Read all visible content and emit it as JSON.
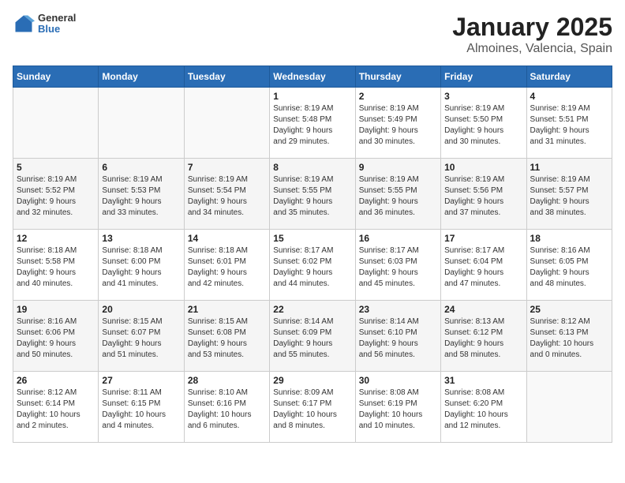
{
  "logo": {
    "general": "General",
    "blue": "Blue"
  },
  "title": "January 2025",
  "subtitle": "Almoines, Valencia, Spain",
  "weekdays": [
    "Sunday",
    "Monday",
    "Tuesday",
    "Wednesday",
    "Thursday",
    "Friday",
    "Saturday"
  ],
  "weeks": [
    [
      {
        "day": "",
        "info": ""
      },
      {
        "day": "",
        "info": ""
      },
      {
        "day": "",
        "info": ""
      },
      {
        "day": "1",
        "info": "Sunrise: 8:19 AM\nSunset: 5:48 PM\nDaylight: 9 hours\nand 29 minutes."
      },
      {
        "day": "2",
        "info": "Sunrise: 8:19 AM\nSunset: 5:49 PM\nDaylight: 9 hours\nand 30 minutes."
      },
      {
        "day": "3",
        "info": "Sunrise: 8:19 AM\nSunset: 5:50 PM\nDaylight: 9 hours\nand 30 minutes."
      },
      {
        "day": "4",
        "info": "Sunrise: 8:19 AM\nSunset: 5:51 PM\nDaylight: 9 hours\nand 31 minutes."
      }
    ],
    [
      {
        "day": "5",
        "info": "Sunrise: 8:19 AM\nSunset: 5:52 PM\nDaylight: 9 hours\nand 32 minutes."
      },
      {
        "day": "6",
        "info": "Sunrise: 8:19 AM\nSunset: 5:53 PM\nDaylight: 9 hours\nand 33 minutes."
      },
      {
        "day": "7",
        "info": "Sunrise: 8:19 AM\nSunset: 5:54 PM\nDaylight: 9 hours\nand 34 minutes."
      },
      {
        "day": "8",
        "info": "Sunrise: 8:19 AM\nSunset: 5:55 PM\nDaylight: 9 hours\nand 35 minutes."
      },
      {
        "day": "9",
        "info": "Sunrise: 8:19 AM\nSunset: 5:55 PM\nDaylight: 9 hours\nand 36 minutes."
      },
      {
        "day": "10",
        "info": "Sunrise: 8:19 AM\nSunset: 5:56 PM\nDaylight: 9 hours\nand 37 minutes."
      },
      {
        "day": "11",
        "info": "Sunrise: 8:19 AM\nSunset: 5:57 PM\nDaylight: 9 hours\nand 38 minutes."
      }
    ],
    [
      {
        "day": "12",
        "info": "Sunrise: 8:18 AM\nSunset: 5:58 PM\nDaylight: 9 hours\nand 40 minutes."
      },
      {
        "day": "13",
        "info": "Sunrise: 8:18 AM\nSunset: 6:00 PM\nDaylight: 9 hours\nand 41 minutes."
      },
      {
        "day": "14",
        "info": "Sunrise: 8:18 AM\nSunset: 6:01 PM\nDaylight: 9 hours\nand 42 minutes."
      },
      {
        "day": "15",
        "info": "Sunrise: 8:17 AM\nSunset: 6:02 PM\nDaylight: 9 hours\nand 44 minutes."
      },
      {
        "day": "16",
        "info": "Sunrise: 8:17 AM\nSunset: 6:03 PM\nDaylight: 9 hours\nand 45 minutes."
      },
      {
        "day": "17",
        "info": "Sunrise: 8:17 AM\nSunset: 6:04 PM\nDaylight: 9 hours\nand 47 minutes."
      },
      {
        "day": "18",
        "info": "Sunrise: 8:16 AM\nSunset: 6:05 PM\nDaylight: 9 hours\nand 48 minutes."
      }
    ],
    [
      {
        "day": "19",
        "info": "Sunrise: 8:16 AM\nSunset: 6:06 PM\nDaylight: 9 hours\nand 50 minutes."
      },
      {
        "day": "20",
        "info": "Sunrise: 8:15 AM\nSunset: 6:07 PM\nDaylight: 9 hours\nand 51 minutes."
      },
      {
        "day": "21",
        "info": "Sunrise: 8:15 AM\nSunset: 6:08 PM\nDaylight: 9 hours\nand 53 minutes."
      },
      {
        "day": "22",
        "info": "Sunrise: 8:14 AM\nSunset: 6:09 PM\nDaylight: 9 hours\nand 55 minutes."
      },
      {
        "day": "23",
        "info": "Sunrise: 8:14 AM\nSunset: 6:10 PM\nDaylight: 9 hours\nand 56 minutes."
      },
      {
        "day": "24",
        "info": "Sunrise: 8:13 AM\nSunset: 6:12 PM\nDaylight: 9 hours\nand 58 minutes."
      },
      {
        "day": "25",
        "info": "Sunrise: 8:12 AM\nSunset: 6:13 PM\nDaylight: 10 hours\nand 0 minutes."
      }
    ],
    [
      {
        "day": "26",
        "info": "Sunrise: 8:12 AM\nSunset: 6:14 PM\nDaylight: 10 hours\nand 2 minutes."
      },
      {
        "day": "27",
        "info": "Sunrise: 8:11 AM\nSunset: 6:15 PM\nDaylight: 10 hours\nand 4 minutes."
      },
      {
        "day": "28",
        "info": "Sunrise: 8:10 AM\nSunset: 6:16 PM\nDaylight: 10 hours\nand 6 minutes."
      },
      {
        "day": "29",
        "info": "Sunrise: 8:09 AM\nSunset: 6:17 PM\nDaylight: 10 hours\nand 8 minutes."
      },
      {
        "day": "30",
        "info": "Sunrise: 8:08 AM\nSunset: 6:19 PM\nDaylight: 10 hours\nand 10 minutes."
      },
      {
        "day": "31",
        "info": "Sunrise: 8:08 AM\nSunset: 6:20 PM\nDaylight: 10 hours\nand 12 minutes."
      },
      {
        "day": "",
        "info": ""
      }
    ]
  ]
}
